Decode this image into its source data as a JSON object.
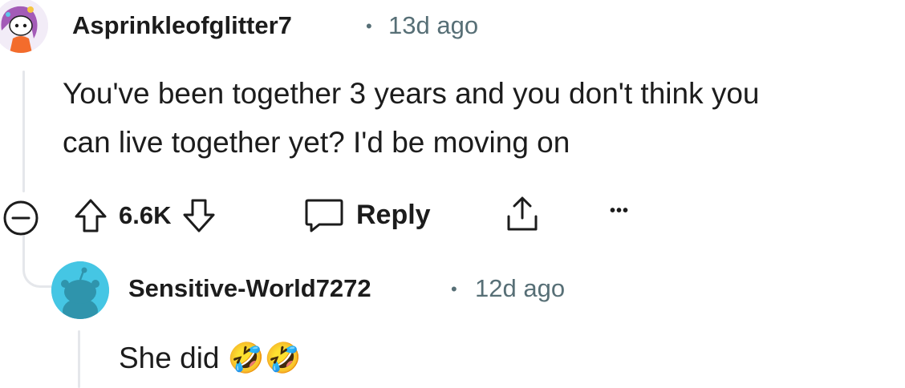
{
  "comment": {
    "username": "Asprinkleofglitter7",
    "separator": "•",
    "time": "13d ago",
    "text_line1": "You've been together 3 years and you don't think you",
    "text_line2": "can live together yet? I'd be moving on"
  },
  "actions": {
    "vote_count": "6.6K",
    "reply_label": "Reply",
    "more_label": "•••"
  },
  "reply": {
    "username": "Sensitive-World7272",
    "separator": "•",
    "time": "12d ago",
    "text": "She did",
    "emoji": "🤣🤣"
  },
  "colors": {
    "meta": "#576f76",
    "thread_line": "#e5e7eb",
    "reply_avatar_bg": "#45c6e4"
  }
}
